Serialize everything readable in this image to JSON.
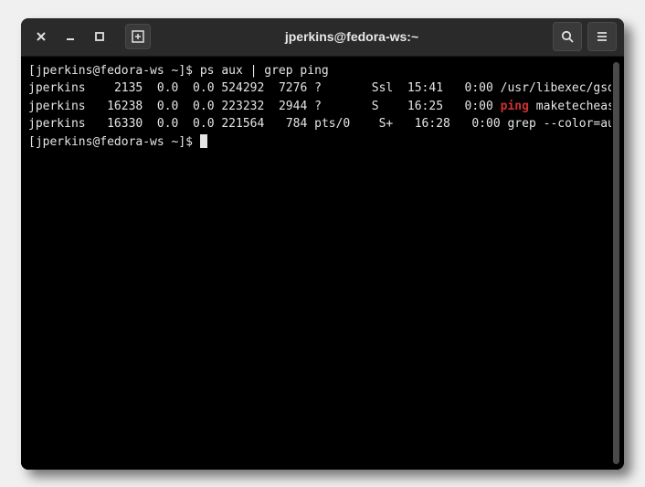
{
  "titlebar": {
    "title": "jperkins@fedora-ws:~"
  },
  "terminal": {
    "prompt": "[jperkins@fedora-ws ~]$ ",
    "command": "ps aux | grep ping",
    "highlight": "ping",
    "processes": [
      {
        "user": "jperkins",
        "pid": "2135",
        "cpu": "0.0",
        "mem": "0.0",
        "vsz": "524292",
        "rss": "7276",
        "tty": "?",
        "stat": "Ssl",
        "start": "15:41",
        "time": "0:00",
        "cmd_prefix": "/usr/libexec/gsd-housekee",
        "cmd_suffix_after_hl": ""
      },
      {
        "user": "jperkins",
        "pid": "16238",
        "cpu": "0.0",
        "mem": "0.0",
        "vsz": "223232",
        "rss": "2944",
        "tty": "?",
        "stat": "S",
        "start": "16:25",
        "time": "0:00",
        "cmd_prefix": "",
        "cmd_suffix_after_hl": " maketecheasier.com"
      },
      {
        "user": "jperkins",
        "pid": "16330",
        "cpu": "0.0",
        "mem": "0.0",
        "vsz": "221564",
        "rss": "784",
        "tty": "pts/0",
        "stat": "S+",
        "start": "16:28",
        "time": "0:00",
        "cmd_prefix": "grep --color=auto ",
        "cmd_suffix_after_hl": ""
      }
    ]
  }
}
